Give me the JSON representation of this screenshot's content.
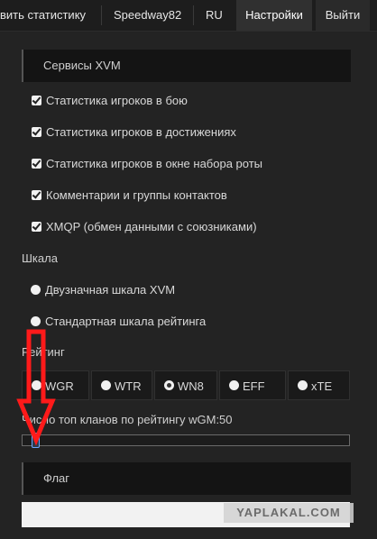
{
  "nav": {
    "stats_label": "вить статистику",
    "user_label": "Speedway82",
    "lang_label": "RU",
    "settings_label": "Настройки",
    "logout_label": "Выйти"
  },
  "xvm_section": {
    "title": "Сервисы XVM",
    "options": [
      {
        "label": "Статистика игроков в бою",
        "checked": true
      },
      {
        "label": "Статистика игроков в достижениях",
        "checked": true
      },
      {
        "label": "Статистика игроков в окне набора роты",
        "checked": true
      },
      {
        "label": "Комментарии и группы контактов",
        "checked": true
      },
      {
        "label": "XMQP (обмен данными с союзниками)",
        "checked": true
      }
    ]
  },
  "scale": {
    "label": "Шкала",
    "options": [
      {
        "label": "Двузначная шкала XVM",
        "selected": false
      },
      {
        "label": "Стандартная шкала рейтинга",
        "selected": false
      }
    ]
  },
  "rating": {
    "label": "Рейтинг",
    "options": [
      {
        "label": "WGR",
        "selected": false
      },
      {
        "label": "WTR",
        "selected": false
      },
      {
        "label": "WN8",
        "selected": true
      },
      {
        "label": "EFF",
        "selected": false
      },
      {
        "label": "xTE",
        "selected": false
      }
    ]
  },
  "top_clans": {
    "label": "Число топ кланов по рейтингу wGM:50",
    "value": 50
  },
  "flag_section": {
    "title": "Флаг"
  },
  "annotation": {
    "arrow_color": "#ff1a1a"
  },
  "watermark": "YAPLAKAL.COM"
}
